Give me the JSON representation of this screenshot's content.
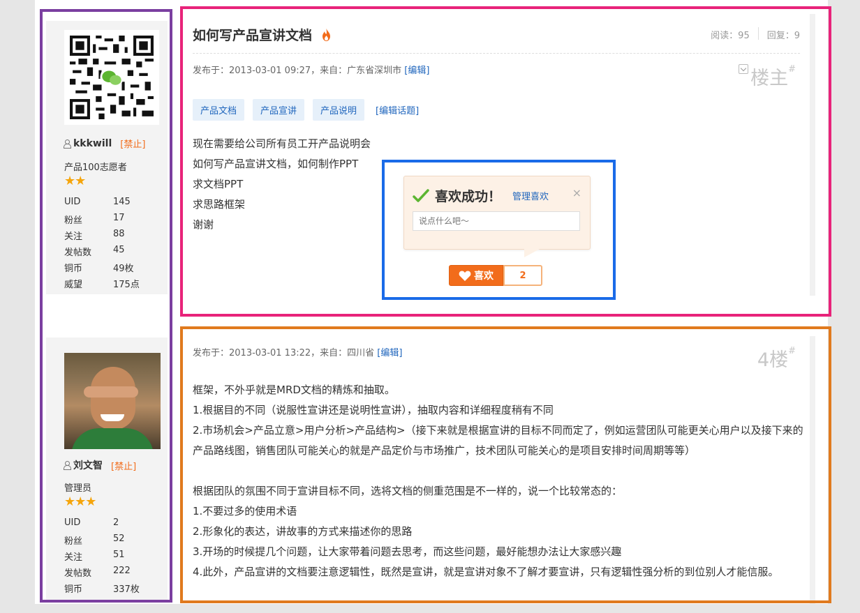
{
  "users": [
    {
      "name": "kkkwill",
      "ban_label": "[禁止]",
      "role": "产品100志愿者",
      "stars": "★★",
      "stats": [
        {
          "k": "UID",
          "v": "145"
        },
        {
          "k": "粉丝",
          "v": "17"
        },
        {
          "k": "关注",
          "v": "88"
        },
        {
          "k": "发帖数",
          "v": "45"
        },
        {
          "k": "铜币",
          "v": "49枚"
        },
        {
          "k": "威望",
          "v": "175点"
        }
      ]
    },
    {
      "name": "刘文智",
      "ban_label": "[禁止]",
      "role": "管理员",
      "stars": "★★★",
      "stats": [
        {
          "k": "UID",
          "v": "2"
        },
        {
          "k": "粉丝",
          "v": "52"
        },
        {
          "k": "关注",
          "v": "51"
        },
        {
          "k": "发帖数",
          "v": "222"
        },
        {
          "k": "铜币",
          "v": "337枚"
        }
      ]
    }
  ],
  "post1": {
    "title": "如何写产品宣讲文档",
    "reads_label": "阅读：95",
    "replies_label": "回复：9",
    "meta": "发布于：2013-03-01 09:27，来自：广东省深圳市",
    "edit_link": "[编辑]",
    "floor": "楼主",
    "floor_mark": "#",
    "tags": [
      "产品文档",
      "产品宣讲",
      "产品说明"
    ],
    "edit_topic": "[编辑话题]",
    "lines": [
      "现在需要给公司所有员工开产品说明会",
      "如何写产品宣讲文档，如何制作PPT",
      "求文档PPT",
      "求思路框架",
      "谢谢"
    ]
  },
  "like_popup": {
    "title": "喜欢成功！",
    "manage_link": "管理喜欢",
    "close": "×",
    "placeholder": "说点什么吧～",
    "button_label": "喜欢",
    "count": "2"
  },
  "post2": {
    "meta": "发布于：2013-03-01 13:22，来自：四川省",
    "edit_link": "[编辑]",
    "floor": "4楼",
    "floor_mark": "#",
    "paragraphs1": [
      "框架，不外乎就是MRD文档的精炼和抽取。",
      "1.根据目的不同（说服性宣讲还是说明性宣讲），抽取内容和详细程度稍有不同",
      "2.市场机会>产品立意>用户分析>产品结构>（接下来就是根据宣讲的目标不同而定了，例如运营团队可能更关心用户以及接下来的产品路线图，销售团队可能关心的就是产品定价与市场推广，技术团队可能关心的是项目安排时间周期等等）"
    ],
    "paragraphs2": [
      "根据团队的氛围不同于宣讲目标不同，选将文档的侧重范围是不一样的，说一个比较常态的：",
      "1.不要过多的使用术语",
      "2.形象化的表达，讲故事的方式来描述你的思路",
      "3.开场的时候提几个问题，让大家带着问题去思考，而这些问题，最好能想办法让大家感兴趣",
      "4.此外，产品宣讲的文档要注意逻辑性，既然是宣讲，就是宣讲对象不了解才要宣讲，只有逻辑性强分析的到位别人才能信服。"
    ]
  },
  "colors": {
    "accent": "#f26c1b",
    "link": "#2066bd",
    "frame_purple": "#7b3fa0",
    "frame_pink": "#e8237a",
    "frame_orange": "#e07a1e",
    "frame_blue": "#1a6be8"
  }
}
